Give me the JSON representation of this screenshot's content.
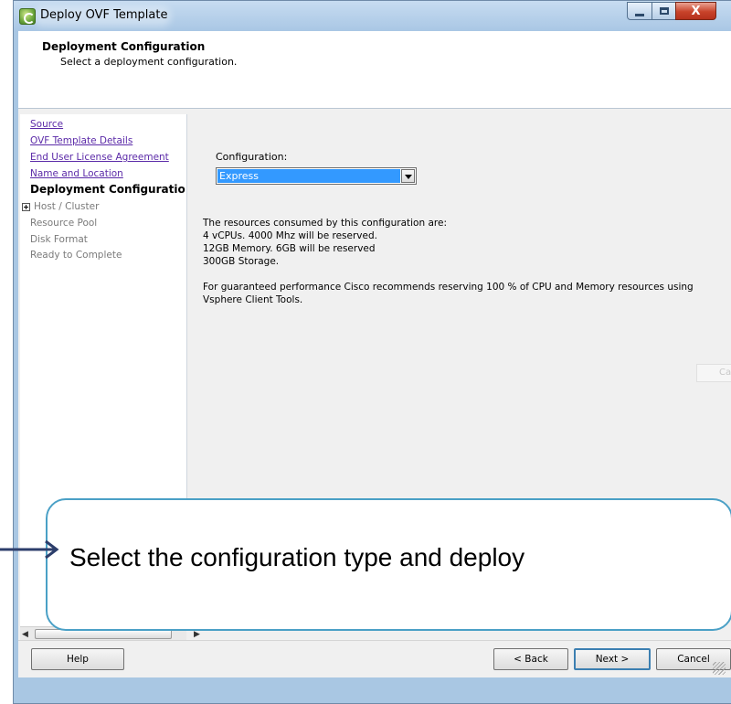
{
  "window": {
    "title": "Deploy OVF Template",
    "close_glyph": "X"
  },
  "header": {
    "title": "Deployment Configuration",
    "subtitle": "Select a deployment configuration."
  },
  "nav": {
    "items": [
      {
        "label": "Source",
        "state": "link"
      },
      {
        "label": "OVF Template Details",
        "state": "link"
      },
      {
        "label": "End User License Agreement",
        "state": "link"
      },
      {
        "label": "Name and Location",
        "state": "link"
      },
      {
        "label": "Deployment Configuration",
        "state": "active"
      },
      {
        "label": "Host / Cluster",
        "state": "disabled"
      },
      {
        "label": "Resource Pool",
        "state": "disabled"
      },
      {
        "label": "Disk Format",
        "state": "disabled"
      },
      {
        "label": "Ready to Complete",
        "state": "disabled"
      }
    ]
  },
  "config": {
    "label": "Configuration:",
    "selected": "Express"
  },
  "resources": {
    "intro": "The resources consumed by this configuration are:",
    "cpu": "4 vCPUs. 4000 Mhz will be reserved.",
    "memory": "12GB Memory.  6GB will be reserved",
    "storage": "300GB Storage.",
    "note_line1": "For guaranteed performance Cisco recommends reserving 100 % of CPU and Memory resources using",
    "note_line2": "Vsphere Client Tools."
  },
  "ghost_button": {
    "label": "Ca"
  },
  "scrollbar": {
    "thumb_glyph": "III"
  },
  "footer": {
    "help": "Help",
    "back": "< Back",
    "next": "Next >",
    "cancel": "Cancel"
  },
  "callout": {
    "text": "Select the configuration  type and deploy"
  },
  "colors": {
    "selection": "#3399ff",
    "link": "#5b2aa8",
    "callout_border": "#4aa0c6",
    "close_button": "#c8432a"
  }
}
